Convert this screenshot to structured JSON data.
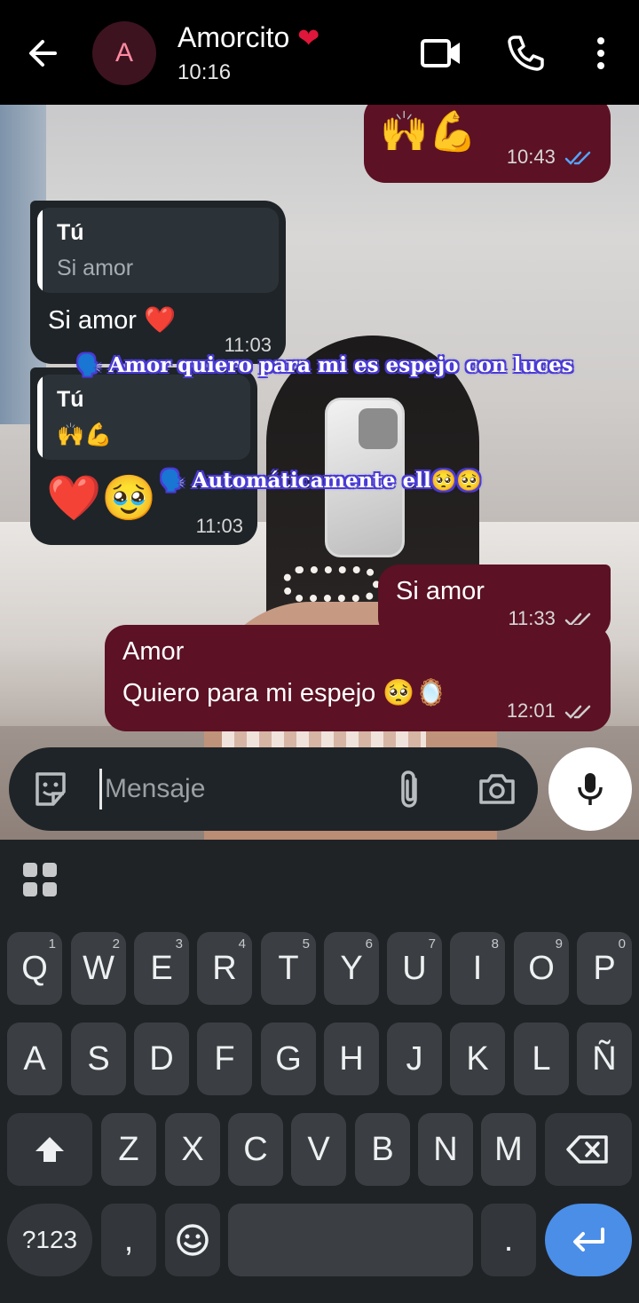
{
  "header": {
    "back_label": "Back",
    "avatar_initial": "A",
    "contact_name": "Amorcito",
    "contact_emoji": "❤",
    "status": "10:16"
  },
  "messages": [
    {
      "id": "m1",
      "direction": "outgoing",
      "text": "🙌💪",
      "time": "10:43",
      "read": true
    },
    {
      "id": "m2",
      "direction": "incoming",
      "quote_author": "Tú",
      "quote_text": "Si amor",
      "text": "Si amor ❤️",
      "time": "11:03"
    },
    {
      "id": "m3",
      "direction": "incoming",
      "quote_author": "Tú",
      "quote_text": "🙌💪",
      "text": "❤️🥹",
      "time": "11:03"
    },
    {
      "id": "m4",
      "direction": "outgoing",
      "text": "Si amor",
      "time": "11:33",
      "read": false
    },
    {
      "id": "m5",
      "direction": "outgoing",
      "line1": "Amor",
      "line2": "Quiero para mi espejo 🥺🪞",
      "time": "12:01",
      "read": false
    }
  ],
  "overlays": {
    "line1": "🗣️ Amor quiero para mi es espejo con luces",
    "line2": "🗣️ Automáticamente ell🥺🥺"
  },
  "composer": {
    "placeholder": "Mensaje"
  },
  "keyboard": {
    "row1": [
      {
        "k": "Q",
        "n": "1"
      },
      {
        "k": "W",
        "n": "2"
      },
      {
        "k": "E",
        "n": "3"
      },
      {
        "k": "R",
        "n": "4"
      },
      {
        "k": "T",
        "n": "5"
      },
      {
        "k": "Y",
        "n": "6"
      },
      {
        "k": "U",
        "n": "7"
      },
      {
        "k": "I",
        "n": "8"
      },
      {
        "k": "O",
        "n": "9"
      },
      {
        "k": "P",
        "n": "0"
      }
    ],
    "row2": [
      "A",
      "S",
      "D",
      "F",
      "G",
      "H",
      "J",
      "K",
      "L",
      "Ñ"
    ],
    "row3": [
      "Z",
      "X",
      "C",
      "V",
      "B",
      "N",
      "M"
    ],
    "symbols_label": "?123",
    "comma_label": ",",
    "period_label": ".",
    "emoji_label": "☺"
  },
  "colors": {
    "outgoing_bubble": "#5c1124",
    "incoming_bubble": "#1f2428",
    "read_ticks": "#53a6ff",
    "unread_ticks": "#cfcfcf",
    "enter_key": "#4a8ee8"
  }
}
